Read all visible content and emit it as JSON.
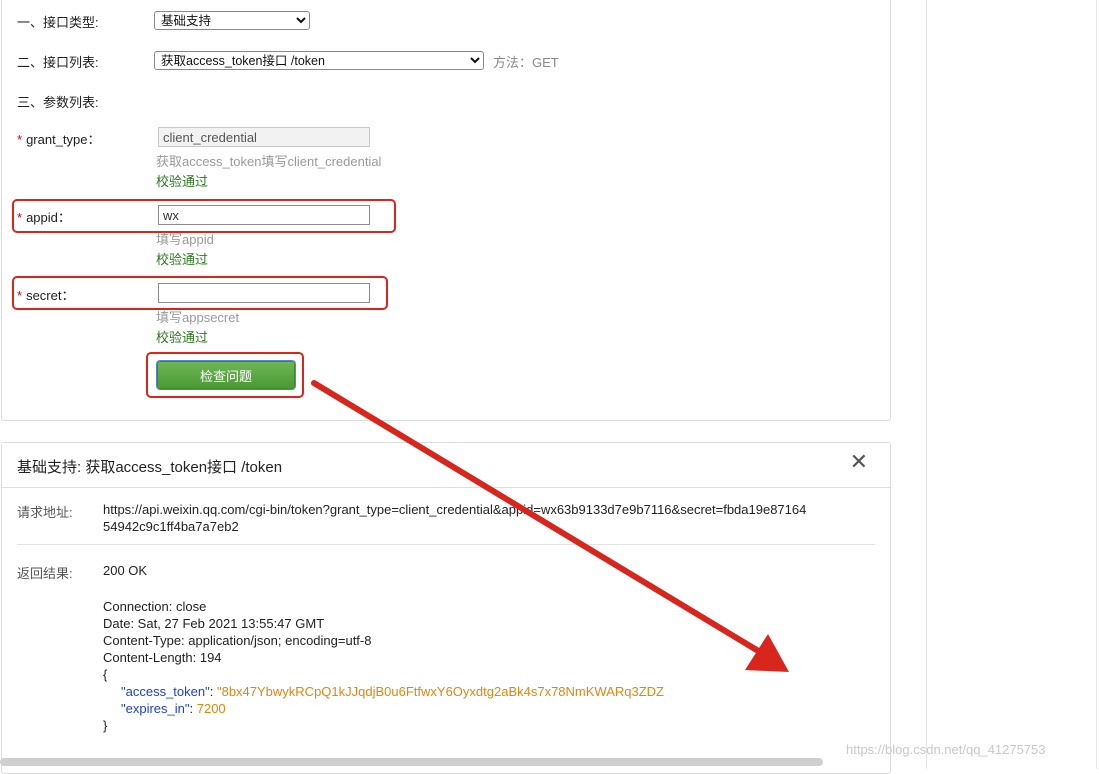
{
  "form": {
    "interface_type": {
      "label": "一、接口类型:",
      "selected": "基础支持"
    },
    "interface_list": {
      "label": "二、接口列表:",
      "selected": "获取access_token接口 /token",
      "method": "方法：GET"
    },
    "param_list_label": "三、参数列表:",
    "grant_type": {
      "label": "grant_type：",
      "value": "client_credential",
      "hint": "获取access_token填写client_credential",
      "status": "校验通过"
    },
    "appid": {
      "label": "appid：",
      "value": "wx",
      "hint": "填写appid",
      "status": "校验通过"
    },
    "secret": {
      "label": "secret：",
      "value": "",
      "hint": "填写appsecret",
      "status": "校验通过"
    },
    "required_mark": "*",
    "submit_label": "检查问题"
  },
  "result": {
    "title": "基础支持: 获取access_token接口 /token",
    "close_glyph": "✕",
    "request_label": "请求地址:",
    "request_url_line1": "https://api.weixin.qq.com/cgi-bin/token?grant_type=client_credential&appid=wx63b9133d7e9b7116&secret=fbda19e87164",
    "request_url_line2": "54942c9c1ff4ba7a7eb2",
    "return_label": "返回结果:",
    "status": "200 OK",
    "headers": [
      "Connection: close",
      "Date: Sat, 27 Feb 2021 13:55:47 GMT",
      "Content-Type: application/json; encoding=utf-8",
      "Content-Length: 194"
    ],
    "json_open": "{",
    "json_close": "}",
    "access_token_key": "\"access_token\"",
    "access_token_value": "\"8bx47YbwykRCpQ1kJJqdjB0u6FtfwxY6Oyxdtg2aBk4s7x78NmKWARq3ZDZ",
    "expires_in_key": "\"expires_in\"",
    "expires_in_value": "7200"
  },
  "watermark": "https://blog.csdn.net/qq_41275753",
  "colors": {
    "annotation_red": "#d9261c",
    "button_green": "#4b9a35",
    "ok_green": "#2a7a1d",
    "json_key_blue": "#1f3fd1",
    "json_value_orange": "#e0860e"
  }
}
